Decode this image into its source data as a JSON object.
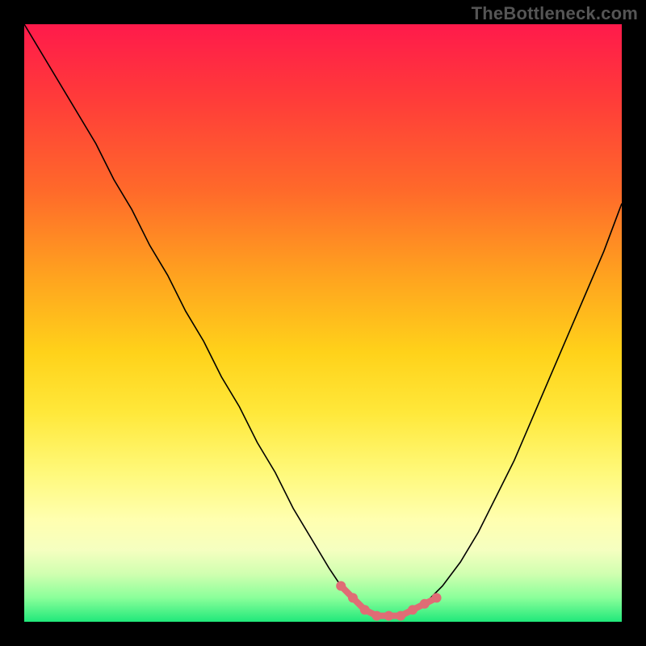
{
  "watermark": "TheBottleneck.com",
  "colors": {
    "frame_bg": "#000000",
    "curve": "#000000",
    "marker": "#e06c75",
    "marker_fill": "#e06c75"
  },
  "chart_data": {
    "type": "line",
    "title": "",
    "xlabel": "",
    "ylabel": "",
    "xlim": [
      0,
      100
    ],
    "ylim": [
      0,
      100
    ],
    "grid": false,
    "legend": false,
    "series": [
      {
        "name": "bottleneck-curve",
        "x": [
          0,
          3,
          6,
          9,
          12,
          15,
          18,
          21,
          24,
          27,
          30,
          33,
          36,
          39,
          42,
          45,
          48,
          51,
          53,
          55,
          57,
          59,
          61,
          63,
          65,
          67,
          70,
          73,
          76,
          79,
          82,
          85,
          88,
          91,
          94,
          97,
          100
        ],
        "y": [
          100,
          95,
          90,
          85,
          80,
          74,
          69,
          63,
          58,
          52,
          47,
          41,
          36,
          30,
          25,
          19,
          14,
          9,
          6,
          4,
          2,
          1,
          1,
          1,
          2,
          3,
          6,
          10,
          15,
          21,
          27,
          34,
          41,
          48,
          55,
          62,
          70
        ]
      }
    ],
    "markers": {
      "name": "flat-minimum",
      "x": [
        53,
        55,
        57,
        59,
        61,
        63,
        65,
        67,
        69
      ],
      "y": [
        6,
        4,
        2,
        1,
        1,
        1,
        2,
        3,
        4
      ]
    }
  }
}
